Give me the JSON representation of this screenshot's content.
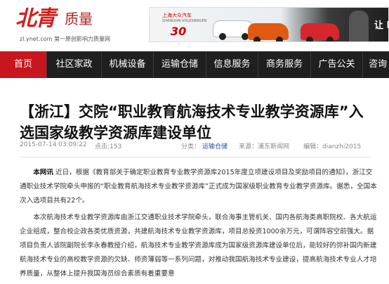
{
  "logo": {
    "brand": "北青",
    "product": "质量",
    "url": "zl.ynet.com",
    "slogan": "第一原创影响力质量网"
  },
  "ad": {
    "brand_cn": "上海大众汽车",
    "brand_en": "SHANGHAI-VOLKSWAGEN",
    "years": "30",
    "right_text": "让 N"
  },
  "nav": {
    "items": [
      "首页",
      "社区家政",
      "机械设备",
      "运输仓储",
      "信息服务",
      "商务服务",
      "广告公关",
      "咨询"
    ],
    "active_index": 0,
    "active_color": "#c7161e"
  },
  "article": {
    "title": "【浙江】交院“职业教育航海技术专业教学资源库”入选国家级教学资源库建设单位",
    "datetime": "2015-07-14 03:09:22",
    "clicks": "点击:153",
    "category_label": "分类：",
    "category": "运输仓储",
    "source": "来源：浦东新闻网",
    "author": "编辑：dianzhi2015",
    "p1_lead": "本网讯",
    "p1": " 近日，根据《教育部关于确定职业教育专业教学资源库2015年度立项建设项目及奖励项目的通知》，浙江交通职业技术学院牵头申报的“职业教育航海技术专业教学资源库”正式成为国家级职业教育专业教学资源库。据悉，全国本次入选项目共有22个。",
    "p2": "本次航海技术专业教学资源库由浙江交通职业技术学院牵头，联合海事主管机关、国内各航海类高职院校、各大航运企业组成，整合校企政各类优质资源，共建航海技术专业教学资源库，项目总投资1000余万元，可谓阵容空前强大。据项目负责人该院副院长李永春教授介绍，航海技术专业教学资源库成为国家级资源库建设单位后，能较好的弥补国内新建航海技术专业的高校教学资源的欠缺、师资薄弱等一系列问题，对推动我国航海技术专业建设，提高航海技术专业人才培养质量，从整体上提升我国海员综合素质有着重要意"
  }
}
